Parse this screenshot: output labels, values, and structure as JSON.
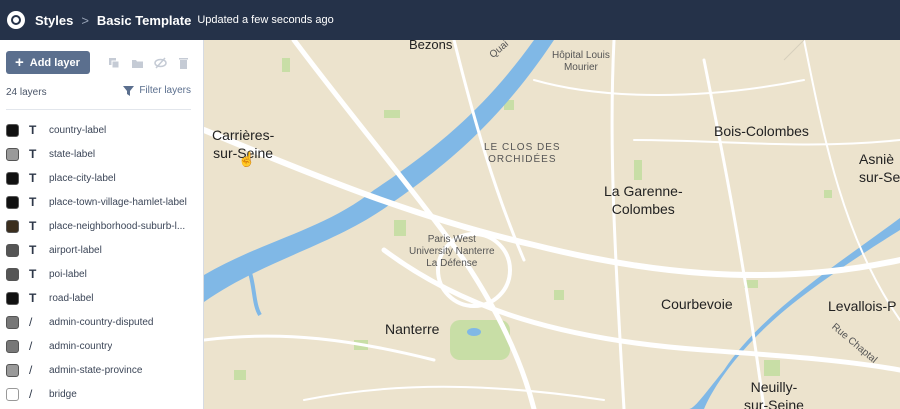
{
  "header": {
    "crumb1": "Styles",
    "crumb_sep": ">",
    "crumb2": "Basic Template",
    "updated": "Updated a few seconds ago"
  },
  "sidebar": {
    "add_button": "Add layer",
    "layer_count": "24 layers",
    "filter": "Filter layers",
    "layers": [
      {
        "name": "country-label",
        "type": "T",
        "swatch": "#111111"
      },
      {
        "name": "state-label",
        "type": "T",
        "swatch": "#9a9a9a"
      },
      {
        "name": "place-city-label",
        "type": "T",
        "swatch": "#111111"
      },
      {
        "name": "place-town-village-hamlet-label",
        "type": "T",
        "swatch": "#111111"
      },
      {
        "name": "place-neighborhood-suburb-l...",
        "type": "T",
        "swatch": "#3b2e1e"
      },
      {
        "name": "airport-label",
        "type": "T",
        "swatch": "#555555"
      },
      {
        "name": "poi-label",
        "type": "T",
        "swatch": "#555555"
      },
      {
        "name": "road-label",
        "type": "T",
        "swatch": "#111111"
      },
      {
        "name": "admin-country-disputed",
        "type": "/",
        "swatch": "#787878"
      },
      {
        "name": "admin-country",
        "type": "/",
        "swatch": "#787878"
      },
      {
        "name": "admin-state-province",
        "type": "/",
        "swatch": "#9a9a9a"
      },
      {
        "name": "bridge",
        "type": "/",
        "swatch": "#ffffff"
      }
    ]
  },
  "map": {
    "labels": {
      "bezons": "Bezons",
      "quai": "Quai",
      "hopital": "Hôpital Louis\nMourier",
      "carrieres": "Carrières-\nsur-Seine",
      "clos": "LE CLOS DES\nORCHIDÉES",
      "bois": "Bois-Colombes",
      "asnieres": "Asniè\nsur-Se",
      "garenne": "La Garenne-\nColombes",
      "paris_west": "Paris West\nUniversity Nanterre\nLa Défense",
      "courbevoie": "Courbevoie",
      "levallois": "Levallois-P",
      "nanterre": "Nanterre",
      "chaptal": "Rue Chaptal",
      "neuilly": "Neuilly-\nsur-Seine"
    }
  }
}
